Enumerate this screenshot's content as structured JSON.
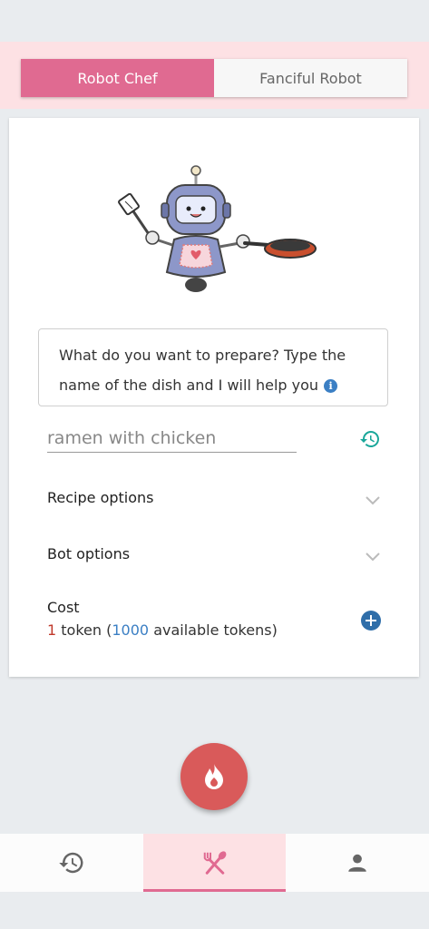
{
  "tabs": [
    {
      "label": "Robot Chef",
      "active": true
    },
    {
      "label": "Fanciful Robot",
      "active": false
    }
  ],
  "prompt": {
    "line1": "What do you want to prepare? Type the",
    "line2": "name of the dish and I will help you",
    "info_icon_glyph": "i"
  },
  "dish_input": {
    "value": "ramen with chicken"
  },
  "sections": {
    "recipe_options": "Recipe options",
    "bot_options": "Bot options",
    "cost_label": "Cost"
  },
  "cost": {
    "token_count": "1",
    "token_word": "token",
    "open_paren": "(",
    "available_count": "1000",
    "available_text": "available tokens)"
  },
  "icons": {
    "history": "history-icon",
    "chevron": "chevron-down-icon",
    "add": "plus-circle-icon",
    "fab": "flame-icon",
    "nav": [
      "history-icon",
      "cutlery-icon",
      "person-icon"
    ]
  },
  "colors": {
    "accent": "#e06a91",
    "fab": "#d95a5a",
    "teal": "#1aa79a",
    "blue": "#3b7fc4",
    "red": "#c0392b"
  }
}
